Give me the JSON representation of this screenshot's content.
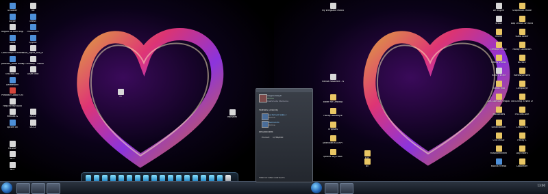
{
  "left_icons": [
    {
      "label": "GSWaker",
      "kind": "app"
    },
    {
      "label": "file",
      "kind": "doc"
    },
    {
      "label": "Skype",
      "kind": "app"
    },
    {
      "label": "iMesh",
      "kind": "app"
    },
    {
      "label": "august 08 dark angel",
      "kind": "doc"
    },
    {
      "label": "PhotoFiltre",
      "kind": "app"
    },
    {
      "label": "Kadis",
      "kind": "app"
    },
    {
      "label": "Spybot",
      "kind": "app"
    },
    {
      "label": "Come Boys Schmetter",
      "kind": "doc"
    },
    {
      "label": "Blue_Lights_and_H",
      "kind": "doc"
    },
    {
      "label": "paradox_robot Installer",
      "kind": "app"
    },
    {
      "label": "DJ Condizey - Hamdup",
      "kind": "doc"
    },
    {
      "label": "this was em",
      "kind": "doc"
    },
    {
      "label": "Olsen Text",
      "kind": "doc"
    },
    {
      "label": "Deletework",
      "kind": "app"
    },
    {
      "label": "Paradise CABAh Online",
      "kind": "red"
    },
    {
      "label": "Help for my build",
      "kind": "doc"
    },
    {
      "label": "Medusa &",
      "kind": "doc"
    },
    {
      "label": "DCC2",
      "kind": "doc"
    },
    {
      "label": "Epcorn all",
      "kind": "app"
    },
    {
      "label": "DCC2",
      "kind": "doc"
    },
    {
      "label": "MEDISP",
      "kind": "doc"
    },
    {
      "label": "NC2",
      "kind": "doc"
    },
    {
      "label": "NC2",
      "kind": "doc"
    }
  ],
  "left_mid_icons": [
    {
      "label": "hi",
      "kind": "doc"
    },
    {
      "label": "Hanselm",
      "kind": "doc"
    }
  ],
  "messenger": {
    "user_name": "magicsmiley0",
    "user_status": "Online",
    "user_message": "Cashmede Starlance",
    "group1": "FRIENDS (2/96/36)",
    "contacts": [
      {
        "name": "ee hjmsjnt w@s.c",
        "status": "Online"
      },
      {
        "name": "Recinando",
        "status": "Online"
      }
    ],
    "group2": "DEALBOOKER",
    "group3_label": "Product",
    "group3_value": "1/786/900",
    "footer": "FIND MY NEW CONTACTS"
  },
  "middle_column": [
    {
      "label": "My Wingsalte Malcom Family 09",
      "kind": "doc"
    },
    {
      "label": "Marisa Rosalette - New Age",
      "kind": "doc"
    },
    {
      "label": "Bilder for Desktop",
      "kind": "folder"
    },
    {
      "label": "Handy Handstyle",
      "kind": "folder"
    },
    {
      "label": "Originals",
      "kind": "folder"
    },
    {
      "label": "Download XSCRIPT",
      "kind": "folder"
    },
    {
      "label": "Iphone Say Fotos",
      "kind": "folder"
    }
  ],
  "right_icons_col1": [
    {
      "label": "BTF",
      "kind": "folder"
    },
    {
      "label": "Bil",
      "kind": "folder"
    }
  ],
  "right_icons_col2": [
    {
      "label": "DR engine",
      "kind": "doc"
    },
    {
      "label": "Kraus",
      "kind": "doc"
    },
    {
      "label": "Innere",
      "kind": "folder"
    },
    {
      "label": "Meetup Online",
      "kind": "folder"
    },
    {
      "label": "Handy Videos",
      "kind": "folder"
    },
    {
      "label": "Handy To Me",
      "kind": "doc"
    },
    {
      "label": "Videos Hub",
      "kind": "folder"
    },
    {
      "label": "Die-Tubmilia Hiraplanpcse",
      "kind": "folder"
    },
    {
      "label": "Instalations",
      "kind": "folder"
    },
    {
      "label": "Schattformer",
      "kind": "folder"
    },
    {
      "label": "Chill Music",
      "kind": "folder"
    },
    {
      "label": "Musikbrennerei",
      "kind": "folder"
    },
    {
      "label": "Mozilla Firefox",
      "kind": "app"
    }
  ],
  "right_icons_col3": [
    {
      "label": "Scopedraft Muole",
      "kind": "folder"
    },
    {
      "label": "Bap Online for Handy",
      "kind": "folder"
    },
    {
      "label": "Sucid Bilder",
      "kind": "folder"
    },
    {
      "label": "Handy Collection",
      "kind": "folder"
    },
    {
      "label": "BCYNET",
      "kind": "folder"
    },
    {
      "label": "Handstyle New",
      "kind": "folder"
    },
    {
      "label": "Compstyle",
      "kind": "folder"
    },
    {
      "label": "Old Living in New Living",
      "kind": "folder"
    },
    {
      "label": "IFSCONCGIIR",
      "kind": "folder"
    },
    {
      "label": "Check Pics",
      "kind": "folder"
    },
    {
      "label": "Handy 1",
      "kind": "folder"
    },
    {
      "label": "Daylinkers",
      "kind": "folder"
    },
    {
      "label": "Cabbreller",
      "kind": "folder"
    }
  ],
  "dock_count": 18,
  "clock": "13:00"
}
